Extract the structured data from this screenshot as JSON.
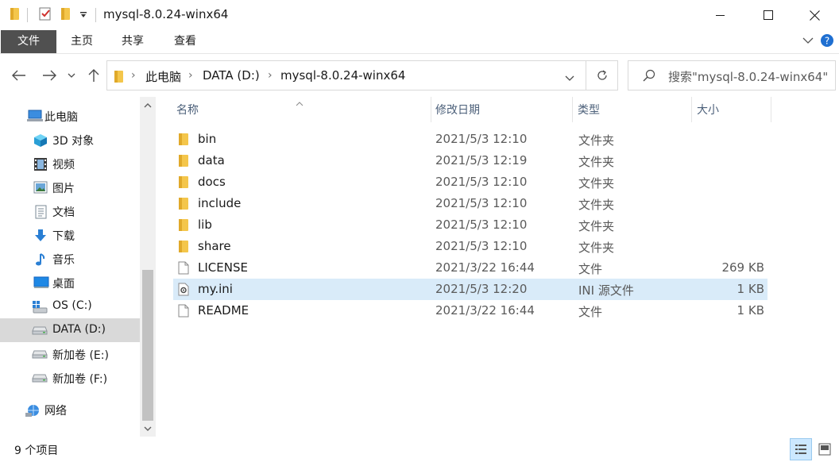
{
  "window": {
    "title": "mysql-8.0.24-winx64"
  },
  "ribbon": {
    "tabs": [
      {
        "label": "文件"
      },
      {
        "label": "主页"
      },
      {
        "label": "共享"
      },
      {
        "label": "查看"
      }
    ]
  },
  "address": {
    "crumbs": [
      "此电脑",
      "DATA (D:)",
      "mysql-8.0.24-winx64"
    ],
    "search_placeholder": "搜索\"mysql-8.0.24-winx64\""
  },
  "sidebar": {
    "items": [
      {
        "label": "此电脑",
        "icon": "computer-icon"
      },
      {
        "label": "3D 对象",
        "icon": "cube-3d-icon"
      },
      {
        "label": "视频",
        "icon": "video-icon"
      },
      {
        "label": "图片",
        "icon": "picture-icon"
      },
      {
        "label": "文档",
        "icon": "document-icon"
      },
      {
        "label": "下载",
        "icon": "download-icon"
      },
      {
        "label": "音乐",
        "icon": "music-icon"
      },
      {
        "label": "桌面",
        "icon": "desktop-icon"
      },
      {
        "label": "OS (C:)",
        "icon": "windows-drive-icon"
      },
      {
        "label": "DATA (D:)",
        "icon": "drive-icon",
        "selected": true
      },
      {
        "label": "新加卷 (E:)",
        "icon": "drive-icon"
      },
      {
        "label": "新加卷 (F:)",
        "icon": "drive-icon"
      },
      {
        "label": "网络",
        "icon": "network-icon"
      }
    ]
  },
  "columns": {
    "name": "名称",
    "modified": "修改日期",
    "type": "类型",
    "size": "大小"
  },
  "files": [
    {
      "name": "bin",
      "modified": "2021/5/3 12:10",
      "type": "文件夹",
      "size": "",
      "icon": "folder-icon"
    },
    {
      "name": "data",
      "modified": "2021/5/3 12:19",
      "type": "文件夹",
      "size": "",
      "icon": "folder-icon"
    },
    {
      "name": "docs",
      "modified": "2021/5/3 12:10",
      "type": "文件夹",
      "size": "",
      "icon": "folder-icon"
    },
    {
      "name": "include",
      "modified": "2021/5/3 12:10",
      "type": "文件夹",
      "size": "",
      "icon": "folder-icon"
    },
    {
      "name": "lib",
      "modified": "2021/5/3 12:10",
      "type": "文件夹",
      "size": "",
      "icon": "folder-icon"
    },
    {
      "name": "share",
      "modified": "2021/5/3 12:10",
      "type": "文件夹",
      "size": "",
      "icon": "folder-icon"
    },
    {
      "name": "LICENSE",
      "modified": "2021/3/22 16:44",
      "type": "文件",
      "size": "269 KB",
      "icon": "file-icon"
    },
    {
      "name": "my.ini",
      "modified": "2021/5/3 12:20",
      "type": "INI 源文件",
      "size": "1 KB",
      "icon": "settings-file-icon",
      "selected": true
    },
    {
      "name": "README",
      "modified": "2021/3/22 16:44",
      "type": "文件",
      "size": "1 KB",
      "icon": "file-icon"
    }
  ],
  "status": {
    "item_count": "9 个项目"
  },
  "colors": {
    "folder": "#f4c64b",
    "selected_row": "#d9ebf9",
    "selected_nav": "#d9d9d9",
    "header_text": "#4c607a"
  }
}
